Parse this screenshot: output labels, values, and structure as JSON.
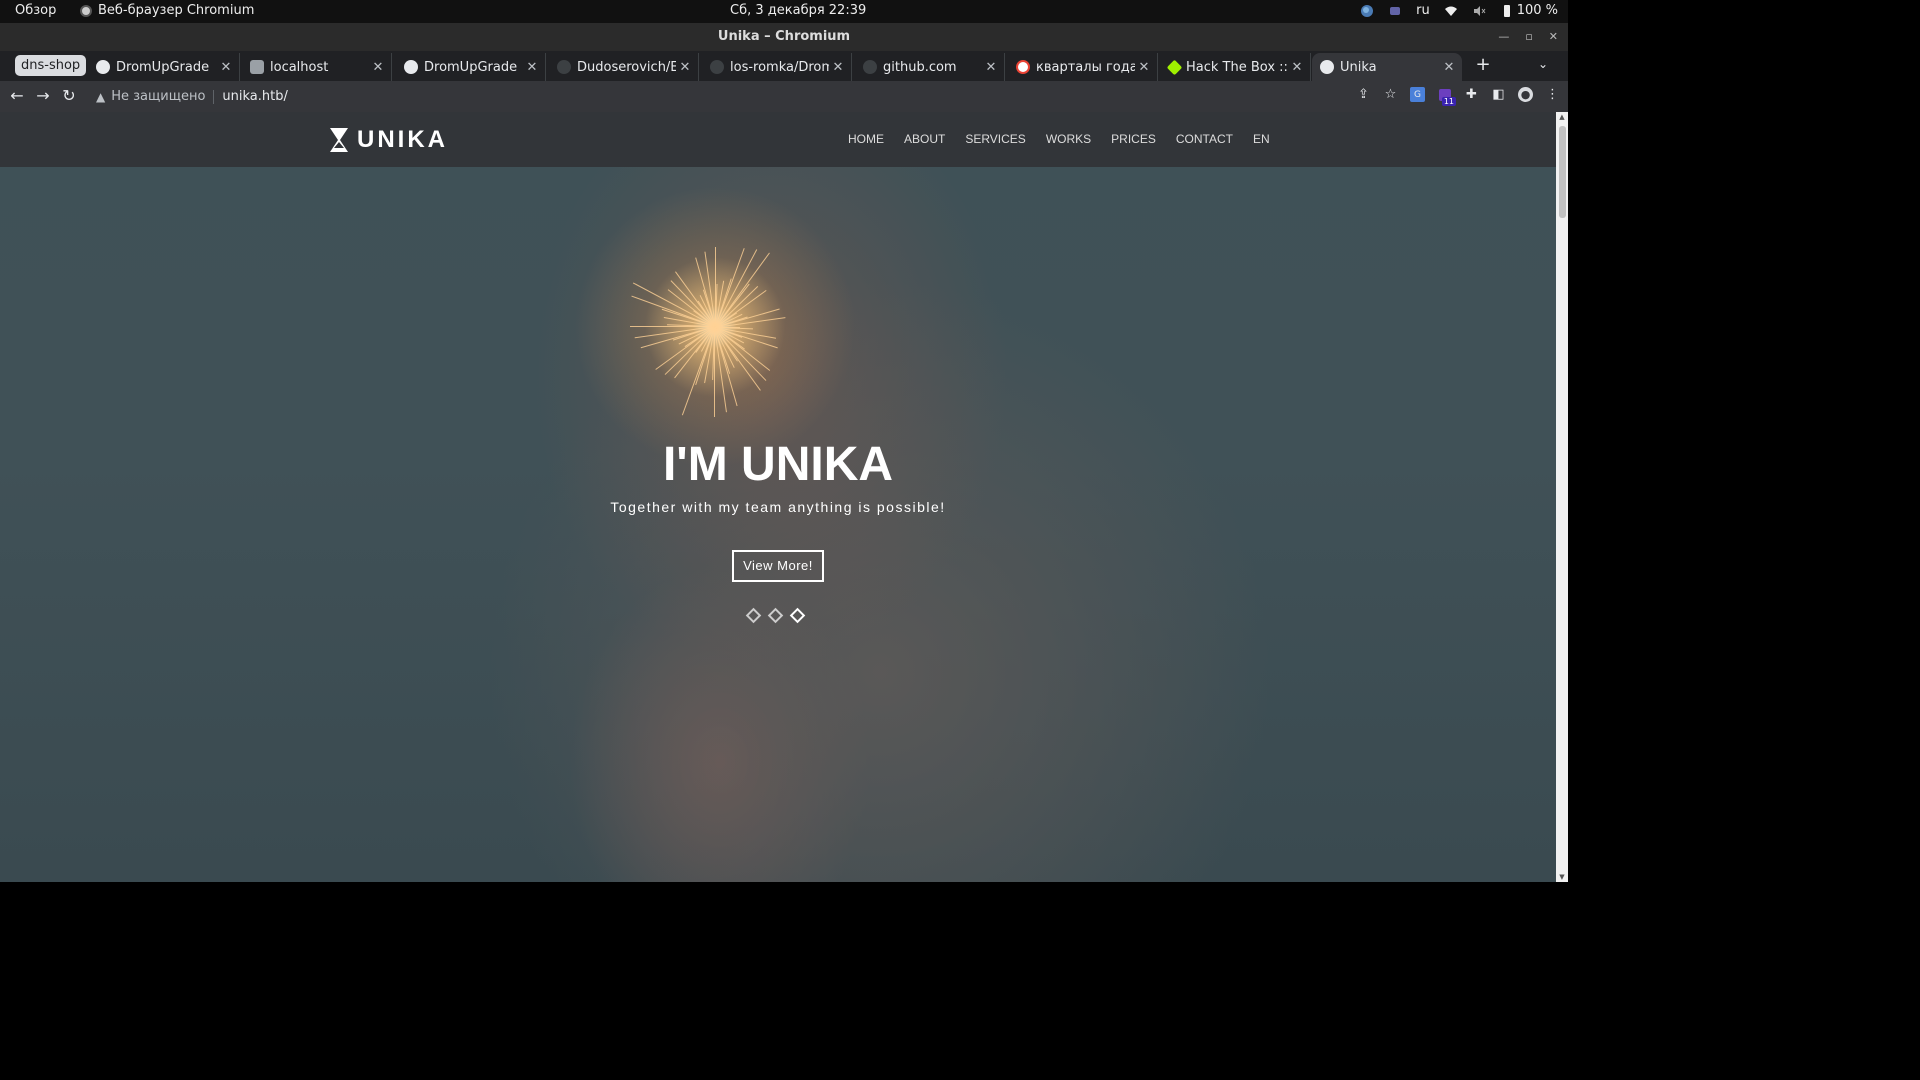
{
  "system": {
    "activities": "Обзор",
    "app_name": "Веб-браузер Chromium",
    "clock": "Сб, 3 декабря  22:39",
    "lang": "ru",
    "battery": "100 %"
  },
  "window": {
    "title": "Unika – Chromium"
  },
  "tabs": {
    "group_label": "dns-shop",
    "items": [
      {
        "label": "DromUpGrade"
      },
      {
        "label": "localhost"
      },
      {
        "label": "DromUpGrade"
      },
      {
        "label": "Dudoserovich/Ed"
      },
      {
        "label": "los-romka/DromU"
      },
      {
        "label": "github.com"
      },
      {
        "label": "кварталы года - П"
      },
      {
        "label": "Hack The Box :: St"
      },
      {
        "label": "Unika"
      }
    ]
  },
  "toolbar": {
    "security_label": "Не защищено",
    "url": "unika.htb/",
    "extension_badge": "11"
  },
  "site": {
    "logo": "UNIKA",
    "menu": [
      "HOME",
      "ABOUT",
      "SERVICES",
      "WORKS",
      "PRICES",
      "CONTACT",
      "EN"
    ],
    "hero": {
      "title": "I'M UNIKA",
      "subtitle": "Together with my team anything is possible!",
      "button": "View More!"
    },
    "carousel": {
      "slides": 3,
      "active": 3
    }
  }
}
